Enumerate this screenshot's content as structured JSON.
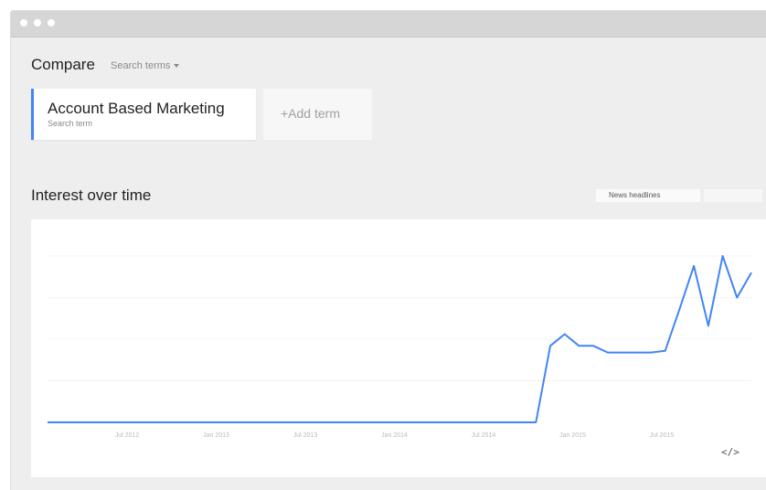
{
  "compare": {
    "title": "Compare",
    "dropdown_label": "Search terms"
  },
  "terms": [
    {
      "name": "Account Based Marketing",
      "subtitle": "Search term",
      "color": "#4285f4"
    }
  ],
  "add_term_label": "+Add term",
  "interest": {
    "title": "Interest over time",
    "news_headlines_label": "News headlines"
  },
  "embed_label": "</>",
  "chart_data": {
    "type": "line",
    "title": "",
    "xlabel": "",
    "ylabel": "",
    "ylim": [
      0,
      100
    ],
    "grid": true,
    "x_tick_labels": [
      "Jul 2012",
      "Jan 2013",
      "Jul 2013",
      "Jan 2014",
      "Jul 2014",
      "Jan 2015",
      "Jul 2015"
    ],
    "series": [
      {
        "color": "#4285f4",
        "values": [
          0,
          0,
          0,
          0,
          0,
          0,
          0,
          0,
          0,
          0,
          0,
          0,
          0,
          0,
          0,
          0,
          0,
          0,
          0,
          0,
          0,
          0,
          0,
          0,
          0,
          0,
          0,
          0,
          0,
          0,
          0,
          0,
          0,
          0,
          0,
          46,
          53,
          46,
          46,
          42,
          42,
          42,
          42,
          43,
          68,
          94,
          58,
          100,
          75,
          90
        ]
      }
    ]
  }
}
